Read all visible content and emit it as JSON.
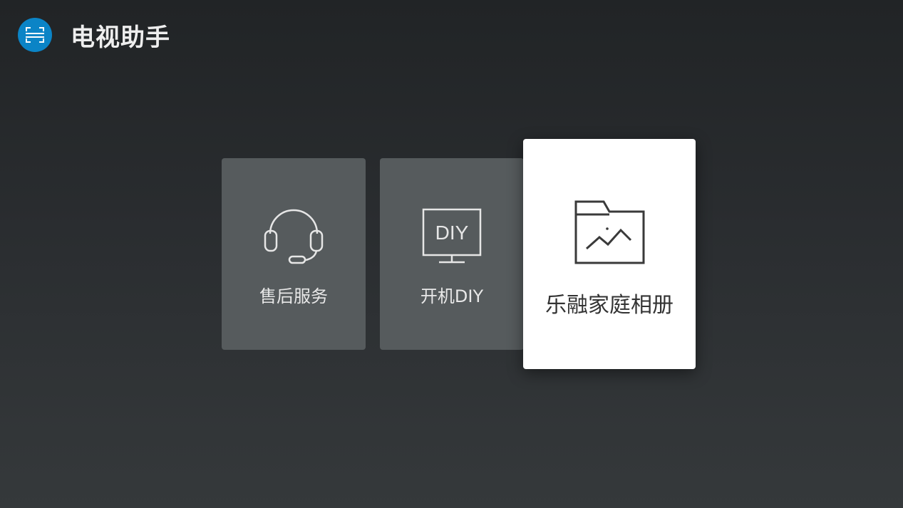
{
  "app": {
    "title": "电视助手",
    "logo_icon": "tv-assistant-logo-icon",
    "logo_color": "#0b84c6"
  },
  "tiles": [
    {
      "label": "售后服务",
      "icon": "headset-icon",
      "focused": false
    },
    {
      "label": "开机DIY",
      "icon": "monitor-diy-icon",
      "icon_text": "DIY",
      "focused": false
    },
    {
      "label": "乐融家庭相册",
      "icon": "photo-album-folder-icon",
      "focused": true
    }
  ],
  "colors": {
    "tile_background": "#565b5d",
    "tile_focused_background": "#ffffff",
    "background_top": "#212426",
    "background_bottom": "#35393b"
  }
}
